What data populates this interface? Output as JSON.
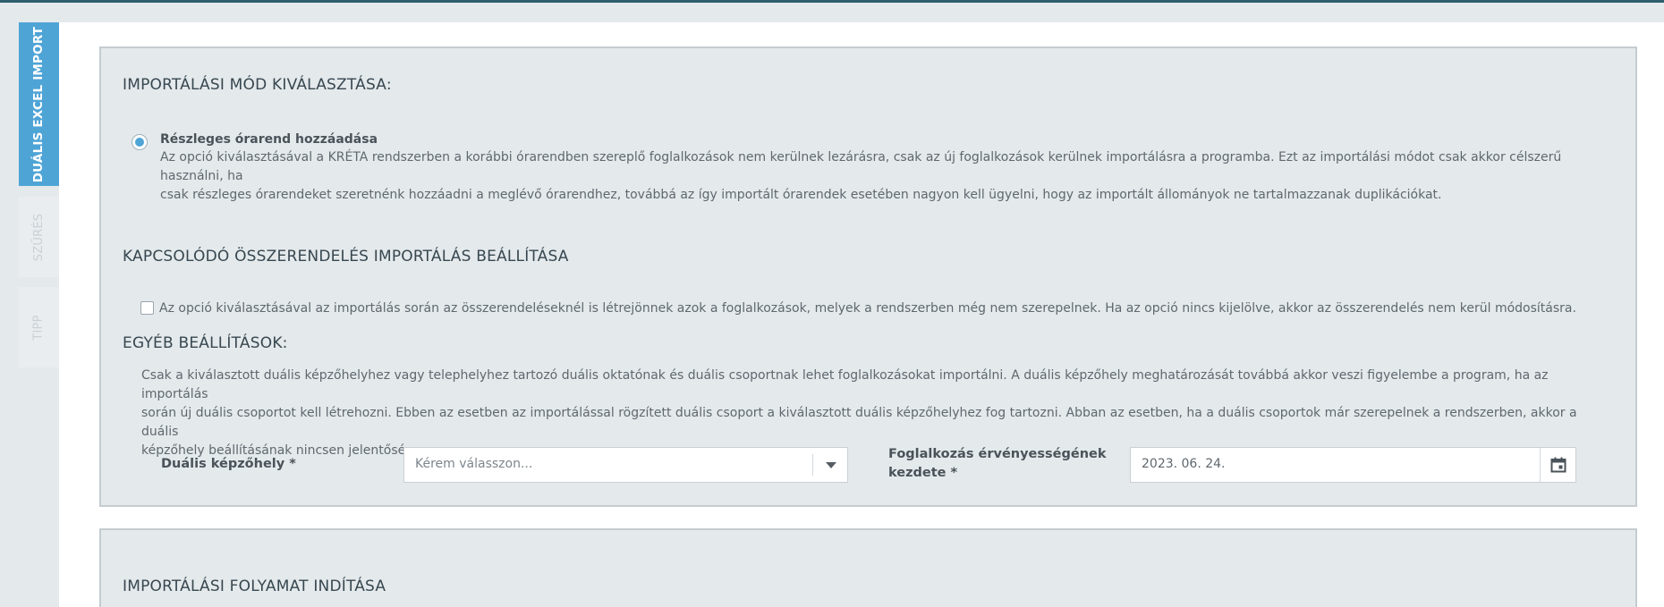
{
  "tabs": [
    {
      "label": "DUÁLIS EXCEL IMPORT",
      "active": true
    },
    {
      "label": "SZŰRÉS",
      "active": false
    },
    {
      "label": "TIPP",
      "active": false
    }
  ],
  "import_mode": {
    "title": "IMPORTÁLÁSI MÓD KIVÁLASZTÁSA:",
    "option_label": "Részleges órarend hozzáadása",
    "option_desc_1": "Az opció kiválasztásával a KRÉTA rendszerben a korábbi órarendben szereplő foglalkozások nem kerülnek lezárásra, csak az új foglalkozások kerülnek importálásra a programba. Ezt az importálási módot csak akkor célszerű használni, ha",
    "option_desc_2": "csak részleges órarendeket szeretnénk hozzáadni a meglévő órarendhez, továbbá az így importált órarendek esetében nagyon kell ügyelni, hogy az importált állományok ne tartalmazzanak duplikációkat."
  },
  "linked_assignment": {
    "title": "KAPCSOLÓDÓ ÖSSZERENDELÉS IMPORTÁLÁS BEÁLLÍTÁSA",
    "checkbox_label": "Az opció kiválasztásával az importálás során az összerendeléseknél is létrejönnek azok a foglalkozások, melyek a rendszerben még nem szerepelnek. Ha az opció nincs kijelölve, akkor az összerendelés nem kerül módosításra.",
    "checked": false
  },
  "other_settings": {
    "title": "EGYÉB BEÁLLÍTÁSOK:",
    "desc_1": "Csak a kiválasztott duális képzőhelyhez vagy telephelyhez tartozó duális oktatónak és duális csoportnak lehet foglalkozásokat importálni. A duális képzőhely meghatározását továbbá akkor veszi figyelembe a program, ha az importálás",
    "desc_2": "során új duális csoportot kell létrehozni. Ebben az esetben az importálással rögzített duális csoport a kiválasztott duális képzőhelyhez fog tartozni. Abban az esetben, ha a duális csoportok már szerepelnek a rendszerben, akkor a duális",
    "desc_3": "képzőhely beállításának nincsen jelentősége."
  },
  "form": {
    "place_label": "Duális képzőhely *",
    "place_placeholder": "Kérem válasszon...",
    "valid_label_1": "Foglalkozás érvényességének",
    "valid_label_2": "kezdete *",
    "valid_value": "2023. 06. 24."
  },
  "start_import": {
    "title": "IMPORTÁLÁSI FOLYAMAT INDÍTÁSA"
  },
  "colors": {
    "accent": "#4fa4d6",
    "background": "#e4e9ec",
    "top_line": "#2d5f6e"
  }
}
